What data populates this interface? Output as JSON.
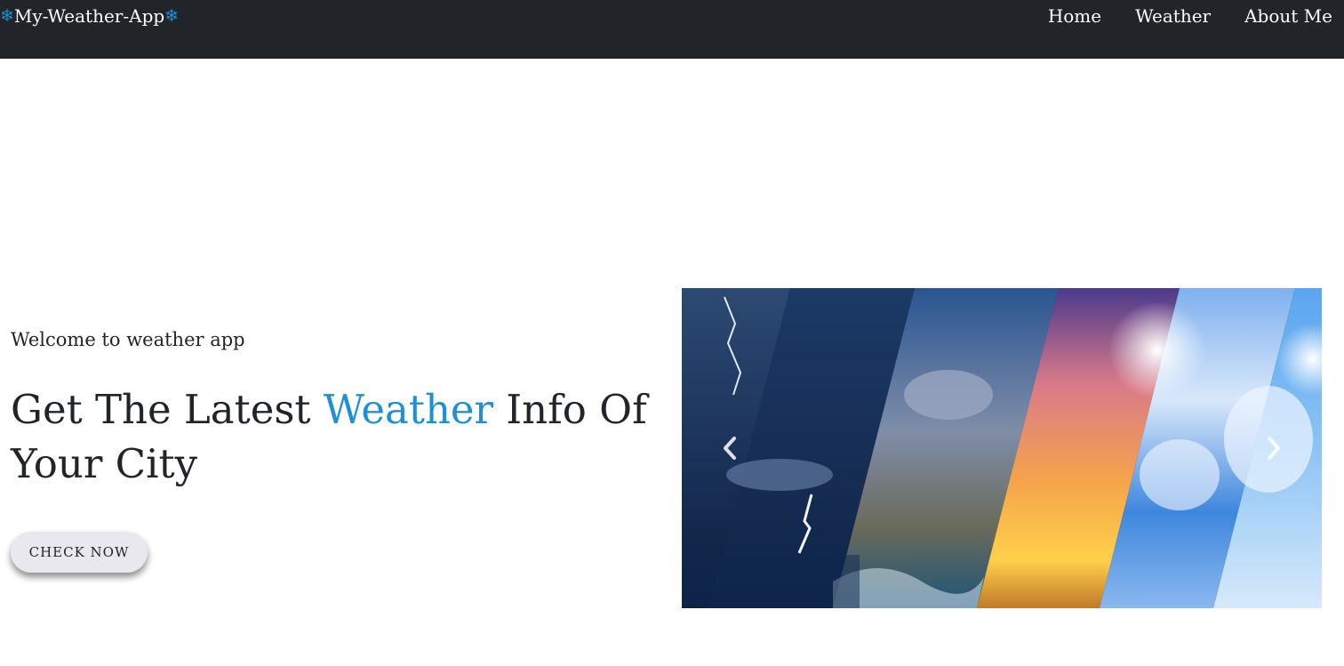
{
  "navbar": {
    "brand": "My-Weather-App",
    "brand_icon": "snowflake-icon",
    "links": [
      "Home",
      "Weather",
      "About Me"
    ]
  },
  "hero": {
    "subtitle": "Welcome to weather app",
    "headline_pre": "Get The Latest ",
    "headline_accent": "Weather",
    "headline_post": " Info Of Your City",
    "cta_label": "CHECK NOW"
  },
  "carousel": {
    "prev_icon": "chevron-left-icon",
    "next_icon": "chevron-right-icon"
  },
  "colors": {
    "navbar_bg": "#212529",
    "accent": "#1e90d6",
    "button_bg": "#e8e8ee"
  }
}
